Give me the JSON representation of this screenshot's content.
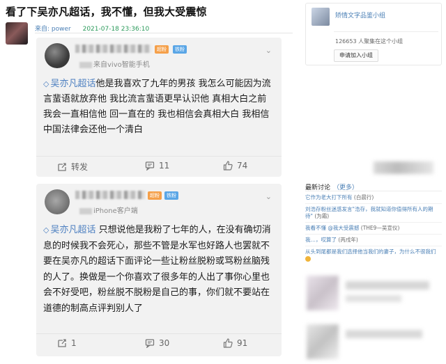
{
  "post": {
    "title": "看了下吴亦凡超话，我不懂，但我大受震惊",
    "meta_from": "来自: power",
    "meta_time": "2021-07-18 23:36:10"
  },
  "comments": [
    {
      "badge_fan": "超粉",
      "badge_level": "铁粉",
      "device": "来自vivo智能手机",
      "topic": "吴亦凡超话",
      "text": "他是我喜欢了九年的男孩 我怎么可能因为流言蜚语就放弃他 我比流言蜚语更早认识他 真相大白之前我会一直相信他 回一直在的 我也相信会真相大白 我相信中国法律会还他一个清白",
      "repost_label": "转发",
      "comment_count": "11",
      "like_count": "74"
    },
    {
      "badge_fan": "超粉",
      "badge_level": "铁粉",
      "device": "iPhone客户端",
      "topic": "吴亦凡超话",
      "text": " 只想说他是我粉了七年的人，在没有确切消息的时候我不会死心，那些不管是水军也好路人也罢就不要在吴亦凡的超话下面评论一些让粉丝脱粉或骂粉丝脑残的人了。换做是一个你喜欢了很多年的人出了事你心里也会不好受吧，粉丝脱不脱粉是自己的事，你们就不要站在道德的制高点评判别人了",
      "repost_count": "1",
      "comment_count": "30",
      "like_count": "91"
    }
  ],
  "sidebar": {
    "group_name": "矫情文字品鉴小组",
    "member_count": "126653 人聚集在这个小组",
    "join_button": "申请加入小组",
    "discussion_title": "最新讨论",
    "discussion_more": "（更多）",
    "discussions": [
      {
        "title": "它作为老大打下所有",
        "author": "(白晨行)"
      },
      {
        "title": "刘浩存粉丝迷惑发言\"浩存，我就知道你值得所有人的期待\"",
        "author": "(为霜)"
      },
      {
        "title": "我看不懂 @我大受震撼",
        "author": "(THE9—吴宣仪)"
      },
      {
        "title": "我…，哎算了",
        "author": "(丙戌年)"
      },
      {
        "title": "从头到尾都是我们选择他当我们的妻子，为什么不很我们",
        "author": ""
      }
    ]
  },
  "colors": {
    "link": "#4a7fb5",
    "topic": "#4c7fc0",
    "badge_orange": "#f5a04a",
    "badge_blue": "#5aa6e6"
  }
}
